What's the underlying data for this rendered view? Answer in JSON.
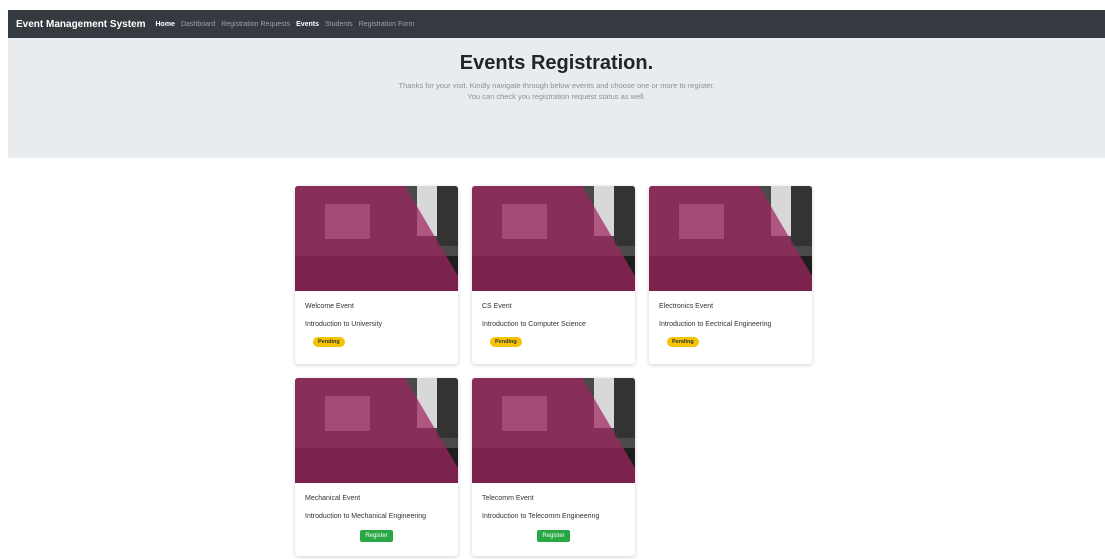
{
  "navbar": {
    "brand": "Event Management System",
    "links": [
      {
        "label": "Home",
        "active": true
      },
      {
        "label": "Dashboard",
        "active": false
      },
      {
        "label": "Registration Requests",
        "active": false
      },
      {
        "label": "Events",
        "active": true
      },
      {
        "label": "Students",
        "active": false
      },
      {
        "label": "Registration Form",
        "active": false
      }
    ]
  },
  "hero": {
    "title": "Events Registration.",
    "line1": "Thanks for your visit. Kindly navigate through below events and choose one or more to register.",
    "line2": "You can check you registration request status as well."
  },
  "colors": {
    "navbar": "#343a40",
    "hero_bg": "#e9ecef",
    "pending": "#f5c400",
    "register": "#28a745",
    "image_overlay": "#a0245f"
  },
  "cards": [
    {
      "title": "Welcome Event",
      "description": "Introduction to University",
      "status": "Pending"
    },
    {
      "title": "CS Event",
      "description": "Introduction to Computer Science",
      "status": "Pending"
    },
    {
      "title": "Electronics Event",
      "description": "Introduction to Eectrical Engineering",
      "status": "Pending"
    },
    {
      "title": "Mechanical Event",
      "description": "Introduction to Mechanical Engineering",
      "action": "Register"
    },
    {
      "title": "Telecomm Event",
      "description": "Introduction to Telecomm Engineering",
      "action": "Register"
    }
  ]
}
